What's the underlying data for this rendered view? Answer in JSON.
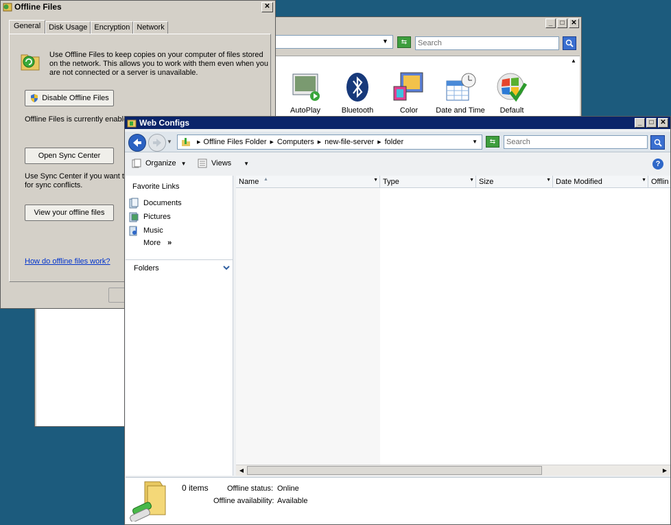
{
  "control_panel": {
    "search_placeholder": "Search",
    "items": [
      {
        "label": "AutoPlay",
        "icon": "autoplay-icon"
      },
      {
        "label": "Bluetooth",
        "icon": "bluetooth-icon"
      },
      {
        "label": "Color",
        "icon": "color-management-icon"
      },
      {
        "label": "Date and Time",
        "icon": "calendar-clock-icon"
      },
      {
        "label": "Default",
        "icon": "default-programs-icon"
      }
    ]
  },
  "offline_files": {
    "title": "Offline Files",
    "tabs": [
      "General",
      "Disk Usage",
      "Encryption",
      "Network"
    ],
    "intro": "Use Offline Files to keep copies on your computer of files stored on the network.  This allows you to work with them even when you are not connected or a server is unavailable.",
    "disable_label": "Disable Offline Files",
    "status_text": "Offline Files is currently enable",
    "sync_label": "Open Sync Center",
    "sync_text": "Use Sync Center if you want t for sync conflicts.",
    "view_label": "View your offline files",
    "help_link": "How do offline files work?"
  },
  "explorer": {
    "title": "Web Configs",
    "breadcrumb": [
      "Offline Files Folder",
      "Computers",
      "new-file-server",
      "folder"
    ],
    "search_placeholder": "Search",
    "toolbar": {
      "organize": "Organize",
      "views": "Views"
    },
    "favorites_header": "Favorite Links",
    "favorites": [
      "Documents",
      "Pictures",
      "Music"
    ],
    "more": "More",
    "folders": "Folders",
    "columns": [
      "Name",
      "Type",
      "Size",
      "Date Modified",
      "Offlin"
    ],
    "details": {
      "count": "0 items",
      "status_label": "Offline status:",
      "status_value": "Online",
      "avail_label": "Offline availability:",
      "avail_value": "Available"
    }
  }
}
